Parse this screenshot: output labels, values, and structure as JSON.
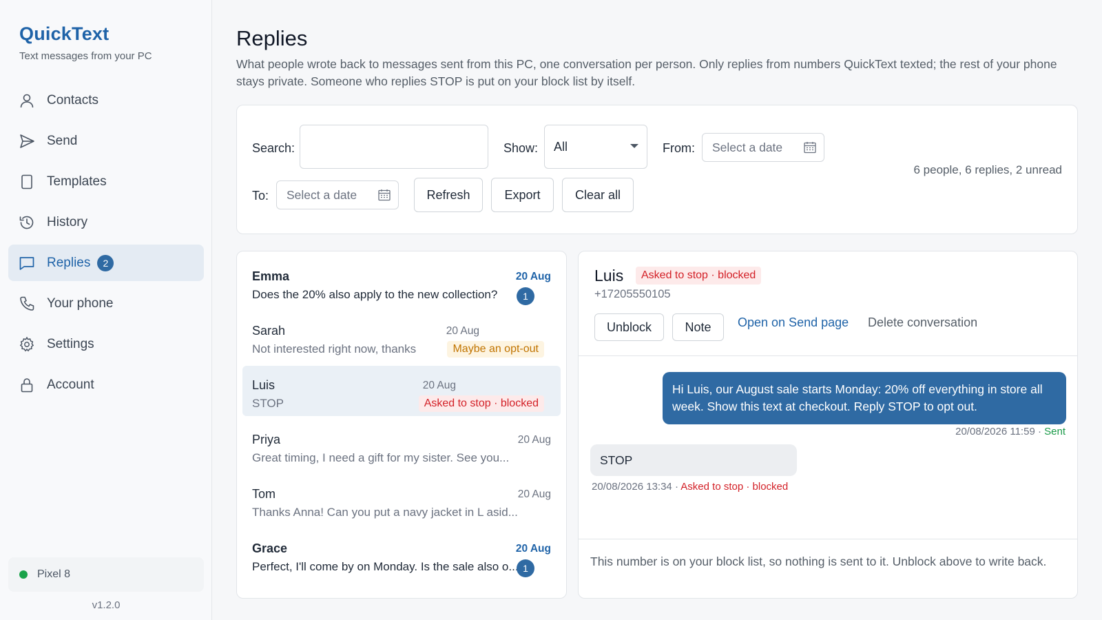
{
  "app": {
    "name": "QuickText",
    "tagline": "Text messages from your PC",
    "version": "v1.2.0",
    "accent": "#1f63a8"
  },
  "sidebar": {
    "items": [
      {
        "label": "Contacts",
        "icon": "person-icon"
      },
      {
        "label": "Send",
        "icon": "send-icon"
      },
      {
        "label": "Templates",
        "icon": "template-icon"
      },
      {
        "label": "History",
        "icon": "history-icon"
      },
      {
        "label": "Replies",
        "icon": "chat-icon",
        "badge": "2",
        "active": true
      },
      {
        "label": "Your phone",
        "icon": "phone-icon"
      },
      {
        "label": "Settings",
        "icon": "gear-icon"
      },
      {
        "label": "Account",
        "icon": "lock-icon"
      }
    ],
    "device": {
      "name": "Pixel 8",
      "status_color": "#1aa34a"
    }
  },
  "page": {
    "title": "Replies",
    "description": "What people wrote back to messages sent from this PC, one conversation per person. Only replies from numbers QuickText texted; the rest of your phone stays private. Someone who replies STOP is put on your block list by itself."
  },
  "filters": {
    "search_label": "Search:",
    "search_value": "",
    "show_label": "Show:",
    "show_value": "All",
    "from_label": "From:",
    "from_placeholder": "Select a date",
    "to_label": "To:",
    "to_placeholder": "Select a date",
    "refresh_label": "Refresh",
    "export_label": "Export",
    "clear_label": "Clear all",
    "summary": "6 people, 6 replies, 2 unread"
  },
  "conversations": [
    {
      "name": "Emma",
      "preview": "Does the 20% also apply to the new collection?",
      "date": "20 Aug",
      "unread": "1"
    },
    {
      "name": "Sarah",
      "preview": "Not interested right now, thanks",
      "date": "20 Aug",
      "tag": "Maybe an opt-out"
    },
    {
      "name": "Luis",
      "preview": "STOP",
      "date": "20 Aug",
      "tag": "Asked to stop · blocked",
      "selected": true
    },
    {
      "name": "Priya",
      "preview": "Great timing, I need a gift for my sister. See you...",
      "date": "20 Aug"
    },
    {
      "name": "Tom",
      "preview": "Thanks Anna! Can you put a navy jacket in L asid...",
      "date": "20 Aug"
    },
    {
      "name": "Grace",
      "preview": "Perfect, I'll come by on Monday. Is the sale also o...",
      "date": "20 Aug",
      "unread": "1"
    }
  ],
  "detail": {
    "name": "Luis",
    "tag": "Asked to stop · blocked",
    "phone": "+17205550105",
    "unblock_label": "Unblock",
    "note_label": "Note",
    "open_send_label": "Open on Send page",
    "delete_label": "Delete conversation",
    "messages": [
      {
        "direction": "out",
        "text": "Hi Luis, our August sale starts Monday: 20% off everything in store all week. Show this text at checkout. Reply STOP to opt out.",
        "timestamp": "20/08/2026 11:59",
        "status": "Sent"
      },
      {
        "direction": "in",
        "text": "STOP",
        "timestamp": "20/08/2026 13:34",
        "status": "Asked to stop · blocked"
      }
    ],
    "separator": " · ",
    "footer": "This number is on your block list, so nothing is sent to it. Unblock above to write back."
  }
}
